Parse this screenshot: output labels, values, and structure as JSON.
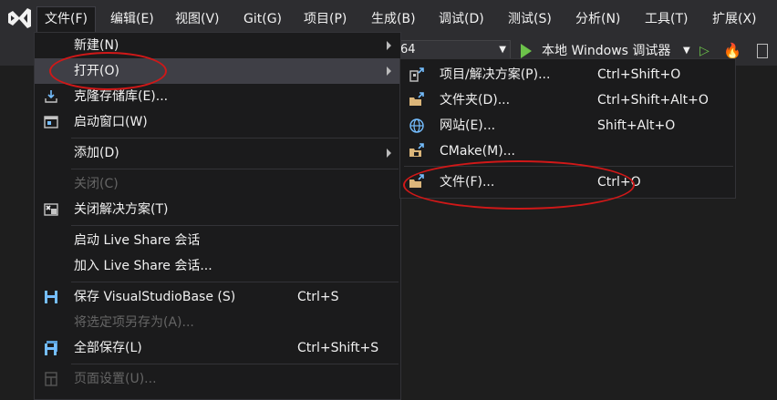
{
  "menubar": {
    "logo": "visual-studio-logo",
    "items": [
      "文件(F)",
      "编辑(E)",
      "视图(V)",
      "Git(G)",
      "项目(P)",
      "生成(B)",
      "调试(D)",
      "测试(S)",
      "分析(N)",
      "工具(T)",
      "扩展(X)"
    ]
  },
  "toolbar": {
    "platform_value": "64",
    "run_label": "本地 Windows 调试器"
  },
  "file_menu": {
    "new": {
      "label": "新建(N)"
    },
    "open": {
      "label": "打开(O)"
    },
    "clone": {
      "label": "克隆存储库(E)..."
    },
    "start_window": {
      "label": "启动窗口(W)"
    },
    "add": {
      "label": "添加(D)"
    },
    "close": {
      "label": "关闭(C)"
    },
    "close_solution": {
      "label": "关闭解决方案(T)"
    },
    "live_share_start": {
      "label": "启动 Live Share 会话"
    },
    "live_share_join": {
      "label": "加入 Live Share 会话..."
    },
    "save": {
      "label": "保存 VisualStudioBase (S)",
      "shortcut": "Ctrl+S"
    },
    "save_as": {
      "label": "将选定项另存为(A)..."
    },
    "save_all": {
      "label": "全部保存(L)",
      "shortcut": "Ctrl+Shift+S"
    },
    "page_setup": {
      "label": "页面设置(U)..."
    }
  },
  "open_submenu": {
    "project": {
      "label": "项目/解决方案(P)...",
      "shortcut": "Ctrl+Shift+O"
    },
    "folder": {
      "label": "文件夹(D)...",
      "shortcut": "Ctrl+Shift+Alt+O"
    },
    "website": {
      "label": "网站(E)...",
      "shortcut": "Shift+Alt+O"
    },
    "cmake": {
      "label": "CMake(M)..."
    },
    "file": {
      "label": "文件(F)...",
      "shortcut": "Ctrl+O"
    }
  },
  "annotation_color": "#d01818"
}
